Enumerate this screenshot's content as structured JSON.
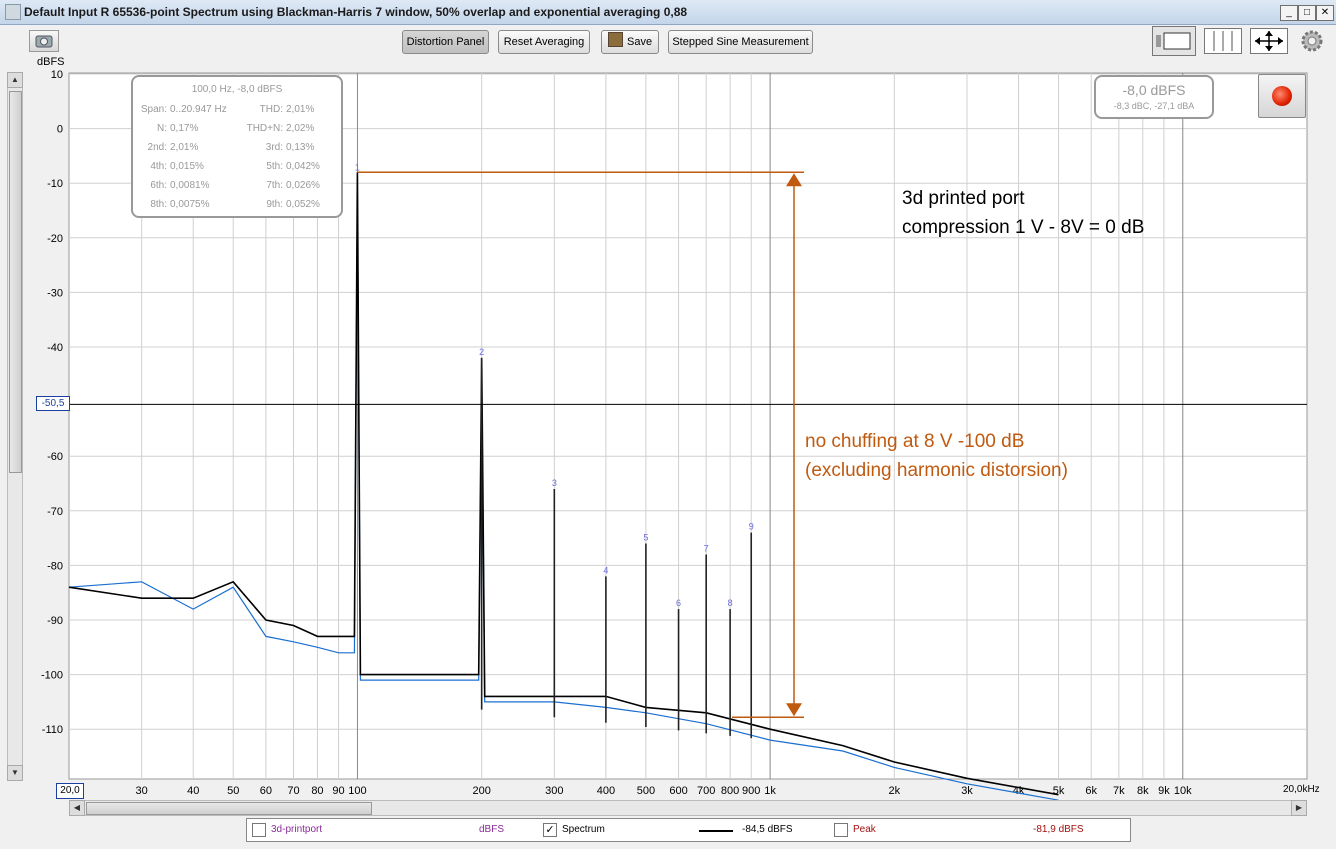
{
  "window": {
    "title": "Default Input R 65536-point Spectrum using Blackman-Harris 7 window, 50% overlap and exponential averaging 0,88"
  },
  "toolbar": {
    "distortion_panel": "Distortion Panel",
    "reset_averaging": "Reset Averaging",
    "save": "Save",
    "stepped_sine": "Stepped Sine Measurement"
  },
  "readout_box": {
    "header": "100,0 Hz, -8,0 dBFS",
    "rows": [
      [
        "Span:",
        "0..20.947 Hz",
        "THD:",
        "2,01%"
      ],
      [
        "N:",
        "0,17%",
        "THD+N:",
        "2,02%"
      ],
      [
        "2nd:",
        "2,01%",
        "3rd:",
        "0,13%"
      ],
      [
        "4th:",
        "0,015%",
        "5th:",
        "0,042%"
      ],
      [
        "6th:",
        "0,0081%",
        "7th:",
        "0,026%"
      ],
      [
        "8th:",
        "0,0075%",
        "9th:",
        "0,052%"
      ]
    ]
  },
  "level_meter": {
    "main": "-8,0 dBFS",
    "sub": "-8,3 dBC, -27,1 dBA"
  },
  "annotations": {
    "compression_line1": "3d printed port",
    "compression_line2": "compression 1 V - 8V = 0 dB",
    "chuffing_line1": "no chuffing at 8 V -100 dB",
    "chuffing_line2": "(excluding harmonic distorsion)"
  },
  "cursor": {
    "value_label": "-50,5"
  },
  "x_axis_edges": {
    "left": "20,0",
    "right": "20,0kHz"
  },
  "legend": {
    "item1_label": "3d-printport",
    "item1_unit": "dBFS",
    "item2_label": "Spectrum",
    "item2_value": "-84,5 dBFS",
    "item3_label": "Peak",
    "item3_value": "-81,9 dBFS"
  },
  "colors": {
    "annotation_orange": "#c05a10",
    "peak_series": "#1a6fd0",
    "main_series": "#000000",
    "grid": "#cccccc"
  },
  "chart_data": {
    "type": "line",
    "xscale": "log",
    "xlim": [
      20,
      20000
    ],
    "ylim": [
      -120,
      10
    ],
    "ylabel": "dBFS",
    "y_ticks": [
      "10",
      "0",
      "-10",
      "-20",
      "-30",
      "-40",
      "-50,5",
      "-60",
      "-70",
      "-80",
      "-90",
      "-100",
      "-110"
    ],
    "x_ticks": [
      "30",
      "40",
      "50",
      "60",
      "70",
      "80",
      "90",
      "100",
      "200",
      "300",
      "400",
      "500",
      "600",
      "700",
      "800",
      "900",
      "1k",
      "2k",
      "3k",
      "4k",
      "5k",
      "6k",
      "7k",
      "8k",
      "9k",
      "10k"
    ],
    "fundamental": {
      "x": 100,
      "y": -8
    },
    "harmonics": [
      {
        "label": "2",
        "x": 200,
        "y": -42
      },
      {
        "label": "3",
        "x": 300,
        "y": -66
      },
      {
        "label": "4",
        "x": 400,
        "y": -82
      },
      {
        "label": "5",
        "x": 500,
        "y": -76
      },
      {
        "label": "6",
        "x": 600,
        "y": -88
      },
      {
        "label": "7",
        "x": 700,
        "y": -78
      },
      {
        "label": "8",
        "x": 800,
        "y": -88
      },
      {
        "label": "9",
        "x": 900,
        "y": -74
      }
    ],
    "series": [
      {
        "name": "Spectrum",
        "x": [
          20,
          30,
          40,
          50,
          60,
          70,
          80,
          90,
          100,
          150,
          200,
          300,
          400,
          500,
          700,
          1000,
          1500,
          2000,
          3000,
          5000
        ],
        "y": [
          -84,
          -86,
          -86,
          -83,
          -90,
          -91,
          -93,
          -93,
          -8,
          -100,
          -42,
          -104,
          -104,
          -106,
          -107,
          -110,
          -113,
          -116,
          -119,
          -122
        ]
      },
      {
        "name": "Peak",
        "x": [
          20,
          30,
          40,
          50,
          60,
          70,
          80,
          90,
          100,
          150,
          200,
          300,
          400,
          500,
          700,
          1000,
          1500,
          2000,
          3000,
          5000
        ],
        "y": [
          -84,
          -83,
          -88,
          -84,
          -93,
          -94,
          -95,
          -96,
          -10,
          -101,
          -44,
          -105,
          -106,
          -107,
          -109,
          -112,
          -114,
          -117,
          -120,
          -123
        ]
      }
    ],
    "grid": true
  }
}
